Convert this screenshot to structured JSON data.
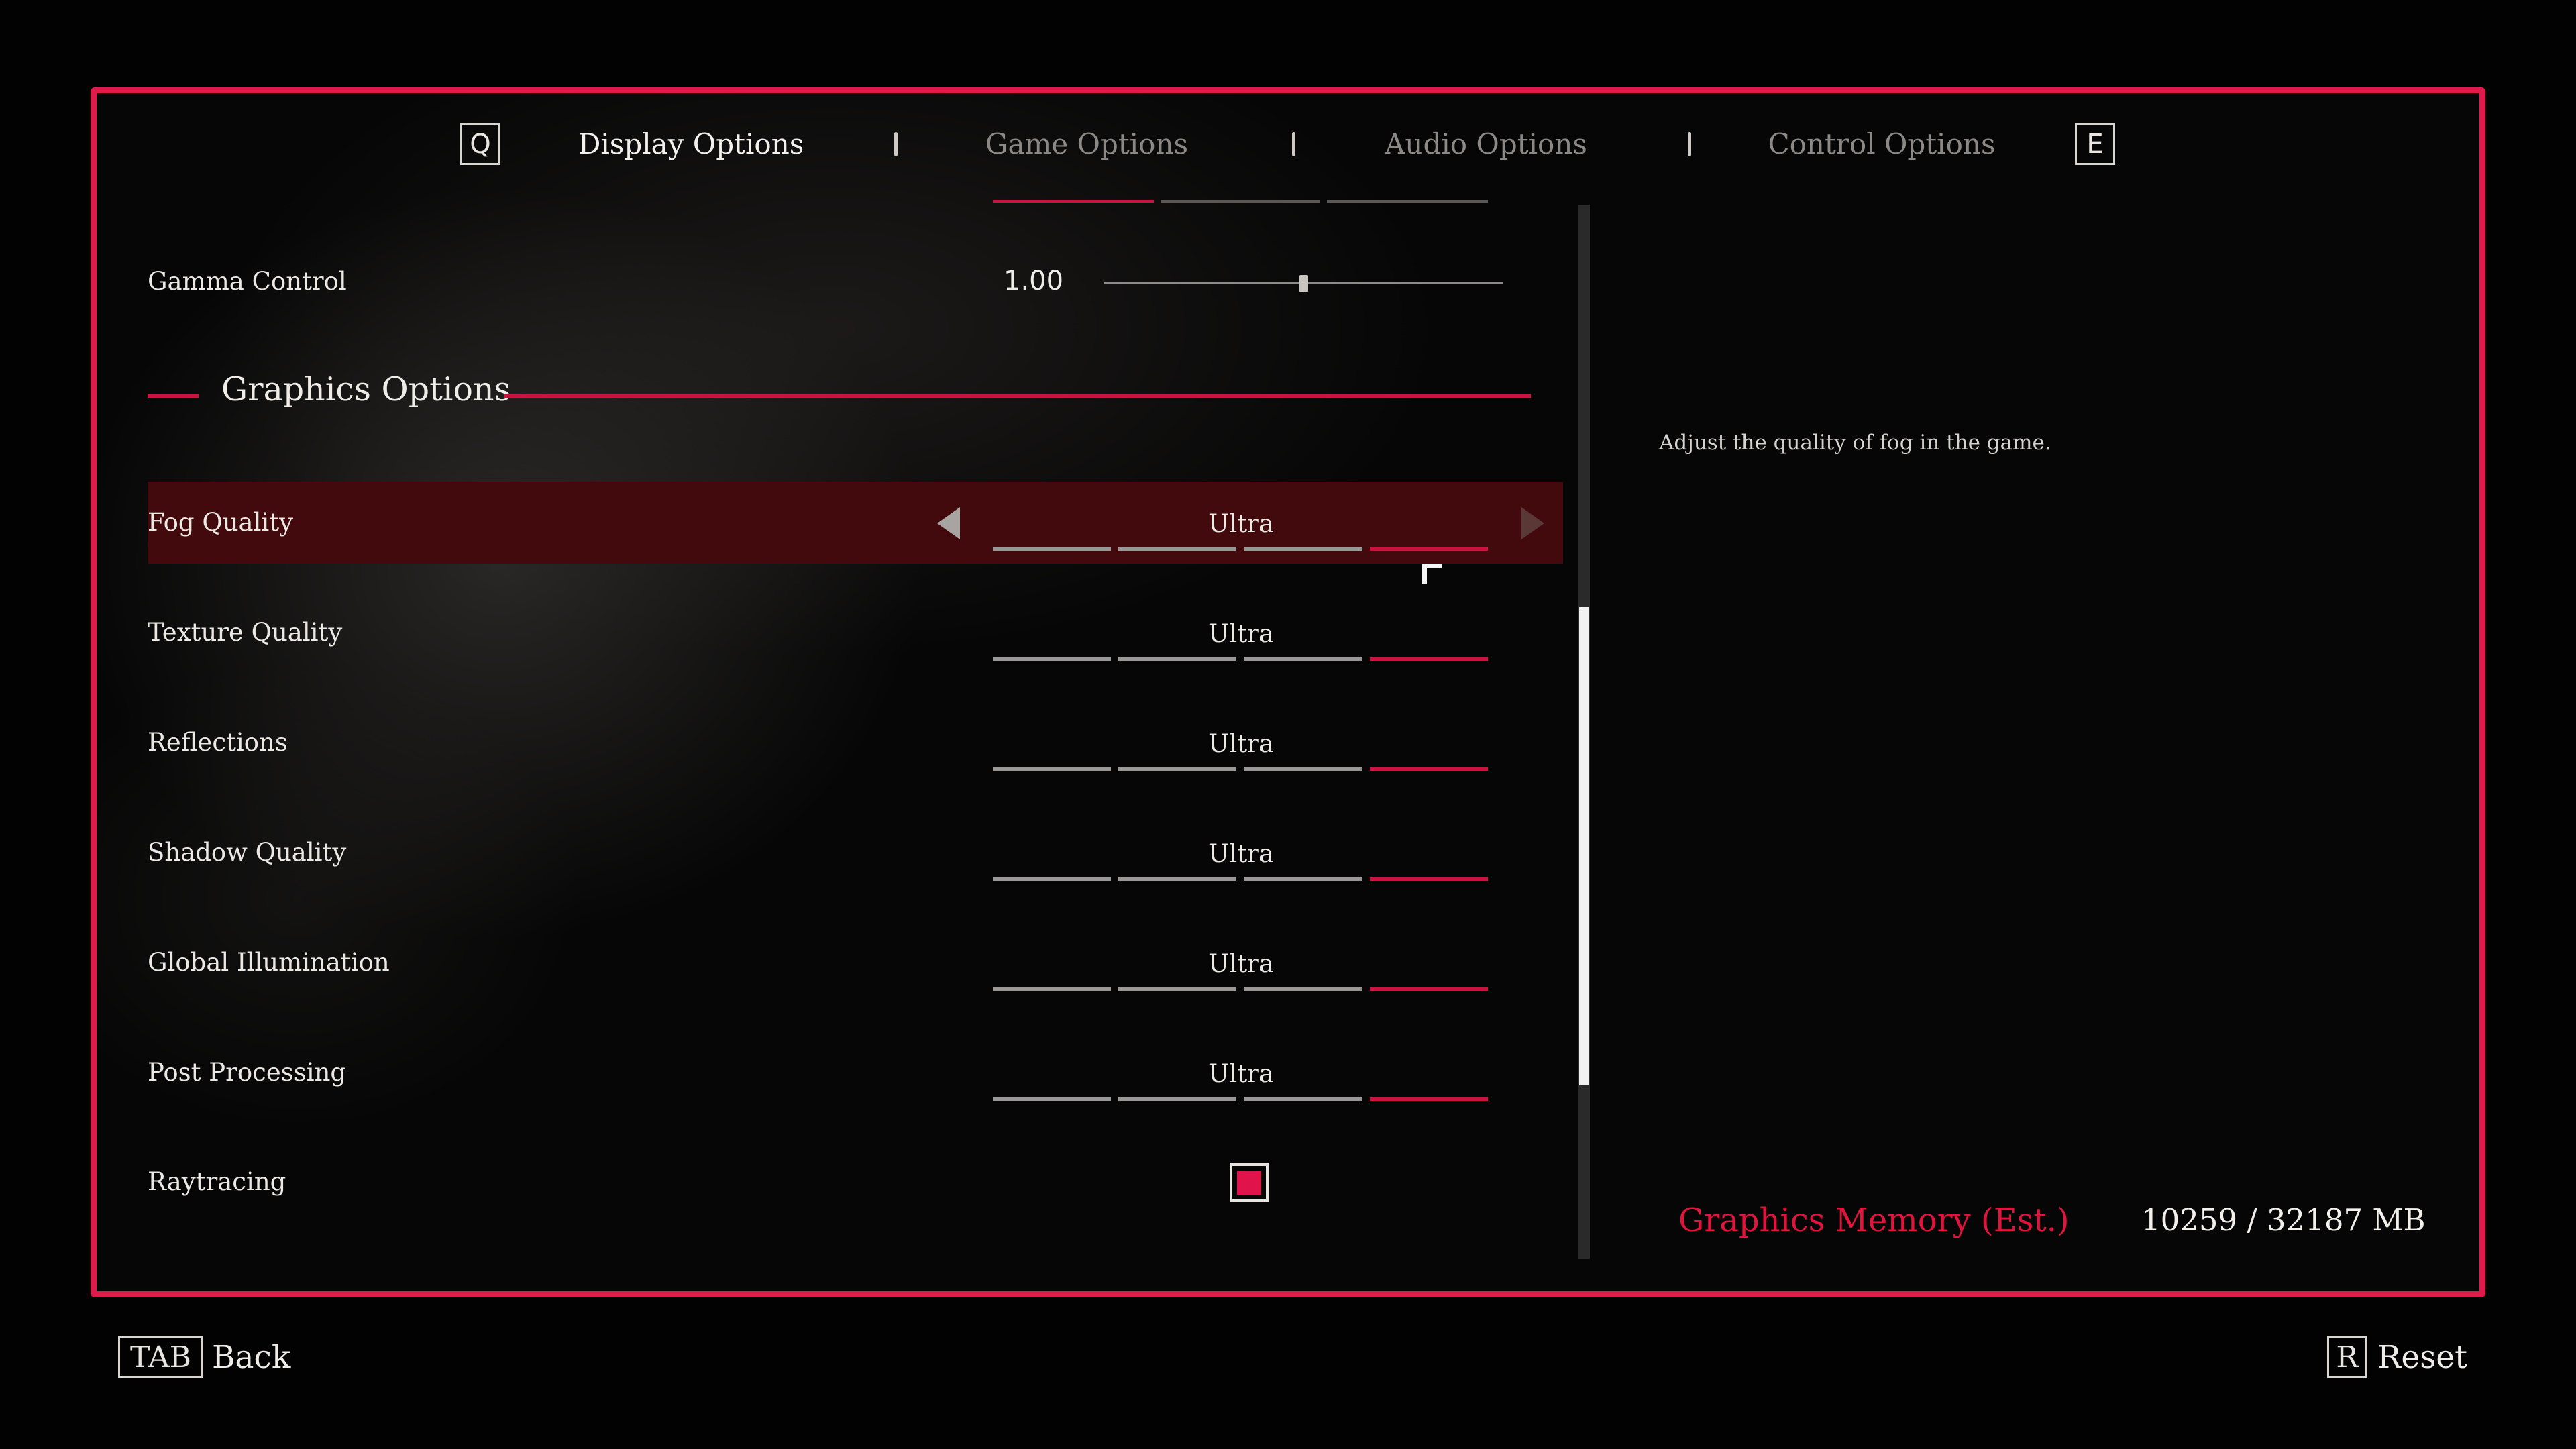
{
  "tabs": {
    "left_key": "Q",
    "right_key": "E",
    "items": [
      {
        "label": "Display Options",
        "active": true
      },
      {
        "label": "Game Options",
        "active": false
      },
      {
        "label": "Audio Options",
        "active": false
      },
      {
        "label": "Control Options",
        "active": false
      }
    ]
  },
  "gamma": {
    "label": "Gamma Control",
    "value": "1.00",
    "slider_fraction": 0.5
  },
  "section": {
    "title": "Graphics Options"
  },
  "settings": [
    {
      "label": "Fog Quality",
      "value": "Ultra",
      "level": 4,
      "selected": true
    },
    {
      "label": "Texture Quality",
      "value": "Ultra",
      "level": 4
    },
    {
      "label": "Reflections",
      "value": "Ultra",
      "level": 4
    },
    {
      "label": "Shadow Quality",
      "value": "Ultra",
      "level": 4
    },
    {
      "label": "Global Illumination",
      "value": "Ultra",
      "level": 4
    },
    {
      "label": "Post Processing",
      "value": "Ultra",
      "level": 4
    }
  ],
  "raytracing": {
    "label": "Raytracing",
    "checked": true
  },
  "description": "Adjust the quality of fog in the game.",
  "memory": {
    "label": "Graphics Memory (Est.)",
    "value": "10259 / 32187 MB"
  },
  "footer": {
    "back_key": "TAB",
    "back_label": "Back",
    "reset_key": "R",
    "reset_label": "Reset"
  },
  "colors": {
    "accent": "#e01a4a",
    "selected_row": "#4a0a0c",
    "memory_label": "#e0143c"
  }
}
